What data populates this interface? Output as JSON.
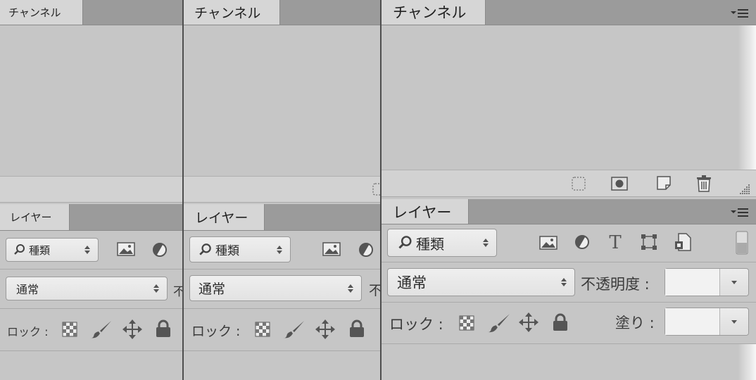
{
  "channels": {
    "tab_label": "チャンネル"
  },
  "layers": {
    "tab_label": "レイヤー",
    "kind_filter": "種類",
    "blend_mode": "通常",
    "opacity_label": "不透明度 :",
    "opacity_label_cut": "不",
    "lock_label": "ロック :",
    "fill_label": "塗り :"
  },
  "icons": [
    "search-icon",
    "image-filter-icon",
    "adjustment-filter-icon",
    "type-filter-icon",
    "shape-filter-icon",
    "smart-object-filter-icon",
    "filter-toggle-icon",
    "lock-transparent-icon",
    "lock-brush-icon",
    "lock-move-icon",
    "lock-all-icon",
    "load-selection-icon",
    "save-mask-icon",
    "new-channel-icon",
    "trash-icon",
    "panel-menu-icon",
    "resize-grip-icon"
  ],
  "colors": {
    "panel_bg": "#c6c6c6",
    "tab_bar": "#9b9b9b",
    "active_tab": "#d6d6d6",
    "divider": "#4e4e4e"
  }
}
